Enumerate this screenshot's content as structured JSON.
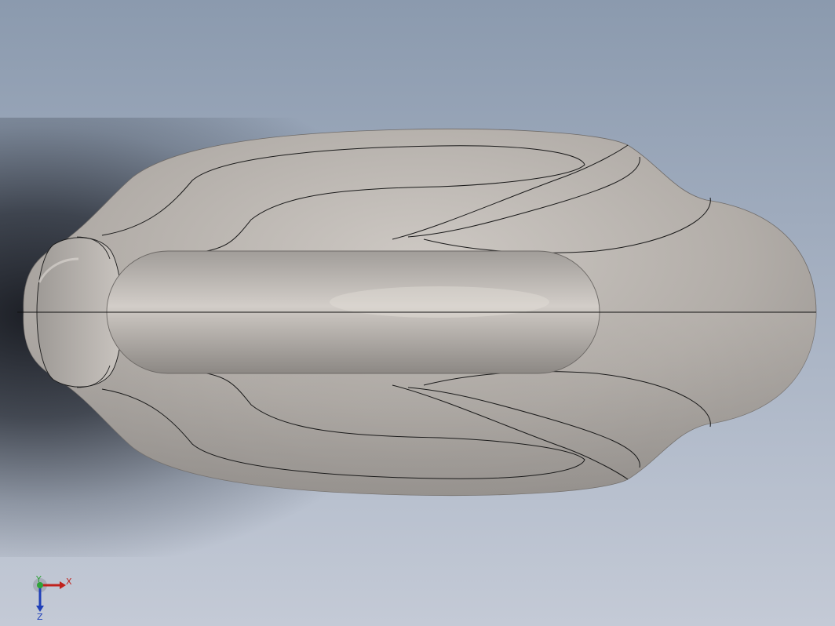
{
  "viewport": {
    "background_top": "#8b9aae",
    "background_bottom": "#c4cad6",
    "model_color": "#b3aeaa",
    "edge_color": "#1a1a1a"
  },
  "triad": {
    "x_label": "X",
    "y_label": "Y",
    "z_label": "Z",
    "x_color": "#c0221d",
    "y_color": "#2fa33a",
    "z_color": "#1f3fb8"
  }
}
